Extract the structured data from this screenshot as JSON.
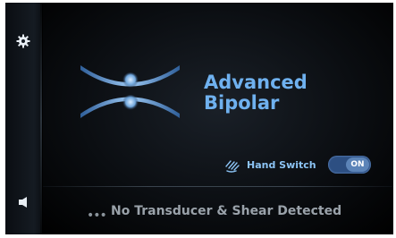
{
  "app": {
    "title_line1": "Advanced",
    "title_line2": "Bipolar"
  },
  "sidebar": {
    "settings_icon": "gear-icon",
    "volume_icon": "speaker-icon"
  },
  "hand_switch": {
    "icon": "hand-icon",
    "label": "Hand Switch",
    "state": "ON"
  },
  "status": {
    "dots": "•••",
    "text": "No Transducer & Shear Detected"
  },
  "colors": {
    "accent": "#6fb1ef",
    "toggle": "#2d4f82"
  }
}
